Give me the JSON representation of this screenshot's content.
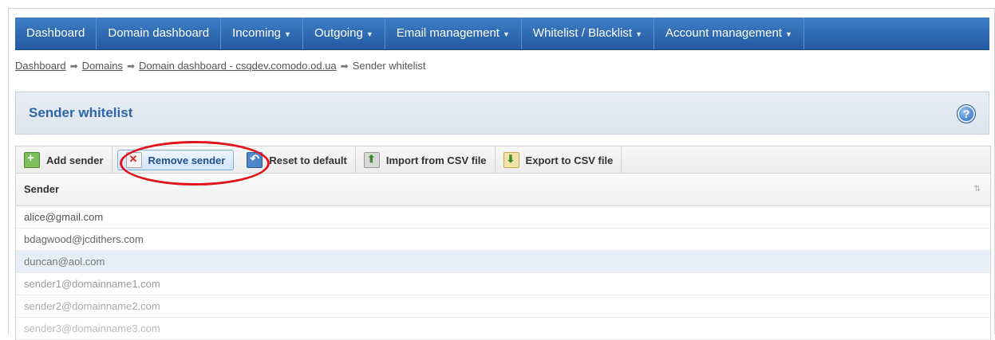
{
  "nav": {
    "items": [
      {
        "label": "Dashboard",
        "caret": false
      },
      {
        "label": "Domain dashboard",
        "caret": false
      },
      {
        "label": "Incoming",
        "caret": true
      },
      {
        "label": "Outgoing",
        "caret": true
      },
      {
        "label": "Email management",
        "caret": true
      },
      {
        "label": "Whitelist / Blacklist",
        "caret": true
      },
      {
        "label": "Account management",
        "caret": true
      }
    ]
  },
  "breadcrumb": {
    "items": [
      "Dashboard",
      "Domains",
      "Domain dashboard - csqdev.comodo.od.ua"
    ],
    "current": "Sender whitelist"
  },
  "section": {
    "title": "Sender whitelist",
    "help": "?"
  },
  "toolbar": {
    "add_label": "Add sender",
    "remove_label": "Remove sender",
    "reset_label": "Reset to default",
    "import_label": "Import from CSV file",
    "export_label": "Export to CSV file"
  },
  "table": {
    "header": "Sender",
    "rows": [
      {
        "email": "alice@gmail.com",
        "color": "#555555"
      },
      {
        "email": "bdagwood@jcdithers.com",
        "color": "#666666"
      },
      {
        "email": "duncan@aol.com",
        "color": "#777777"
      },
      {
        "email": "sender1@domainname1.com",
        "color": "#999999"
      },
      {
        "email": "sender2@domainname2.com",
        "color": "#aaaaaa"
      },
      {
        "email": "sender3@domainname3.com",
        "color": "#bbbbbb"
      }
    ]
  },
  "colors": {
    "nav_blue": "#2d68b0",
    "title_blue": "#2e66ad",
    "annotation_red": "#e0141a",
    "row_highlight": "#e7eef8"
  }
}
